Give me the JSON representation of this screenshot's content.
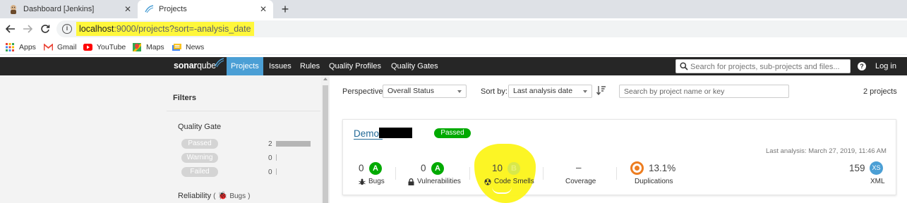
{
  "browser": {
    "tabs": [
      {
        "title": "Dashboard [Jenkins]",
        "active": false
      },
      {
        "title": "Projects",
        "active": true
      }
    ],
    "url_highlight": "localhost",
    "url_rest": ":9000/projects?sort=-analysis_date",
    "bookmarks": [
      {
        "label": "Apps",
        "icon": "apps-grid-icon"
      },
      {
        "label": "Gmail",
        "icon": "gmail-icon"
      },
      {
        "label": "YouTube",
        "icon": "youtube-icon"
      },
      {
        "label": "Maps",
        "icon": "maps-icon"
      },
      {
        "label": "News",
        "icon": "news-icon"
      }
    ],
    "highlight_color": "#fff73b"
  },
  "header": {
    "logo_bold": "sonar",
    "logo_rest": "qube",
    "nav": [
      "Projects",
      "Issues",
      "Rules",
      "Quality Profiles",
      "Quality Gates"
    ],
    "active_nav": "Projects",
    "search_placeholder": "Search for projects, sub-projects and files...",
    "login": "Log in",
    "accent_color": "#4b9fd5"
  },
  "filters": {
    "title": "Filters",
    "quality_gate": {
      "title": "Quality Gate",
      "items": [
        {
          "label": "Passed",
          "count": "2",
          "share": 1.0
        },
        {
          "label": "Warning",
          "count": "0",
          "share": 0
        },
        {
          "label": "Failed",
          "count": "0",
          "share": 0
        }
      ]
    },
    "reliability": {
      "title": "Reliability",
      "open_paren": "(",
      "sub": "Bugs",
      "close_paren": ")"
    }
  },
  "toolbar": {
    "perspective_label": "Perspective:",
    "perspective_value": "Overall Status",
    "sortby_label": "Sort by:",
    "sortby_value": "Last analysis date",
    "search_placeholder": "Search by project name or key",
    "count": "2 projects"
  },
  "project": {
    "name": "Demo-",
    "gate": "Passed",
    "gate_color": "#00aa00",
    "last_analysis": "Last analysis: March 27, 2019, 11:46 AM",
    "metrics": {
      "bugs": {
        "value": "0",
        "rating": "A",
        "label": "Bugs",
        "color": "#00aa00"
      },
      "vulnerabilities": {
        "value": "0",
        "rating": "A",
        "label": "Vulnerabilities",
        "color": "#00aa00"
      },
      "code_smells": {
        "value": "10",
        "rating": "B",
        "label": "Code Smells",
        "color": "#b0d513"
      },
      "coverage": {
        "value": "–",
        "label": "Coverage"
      },
      "duplications": {
        "value": "13.1%",
        "label": "Duplications",
        "color": "#ed7d20"
      },
      "size": {
        "value": "159",
        "rating": "XS",
        "label": "XML",
        "color": "#4b9fd5"
      }
    }
  }
}
